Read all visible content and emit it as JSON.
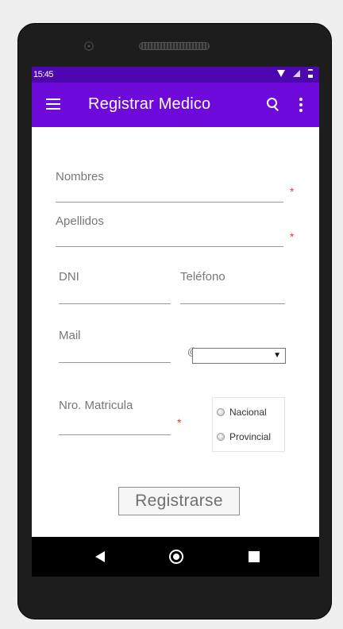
{
  "status_bar": {
    "time": "15:45"
  },
  "app_bar": {
    "title": "Registrar Medico"
  },
  "form": {
    "nombres_label": "Nombres",
    "apellidos_label": "Apellidos",
    "dni_label": "DNI",
    "telefono_label": "Teléfono",
    "mail_label": "Mail",
    "at_sign": "@",
    "domain_selected": "",
    "matricula_label": "Nro. Matricula",
    "required_mark": "*",
    "matricula_types": [
      "Nacional",
      "Provincial"
    ],
    "submit_label": "Registrarse"
  },
  "colors": {
    "status_bar": "#4d07b0",
    "app_bar": "#6e0bdb",
    "required": "#e23c3c"
  }
}
